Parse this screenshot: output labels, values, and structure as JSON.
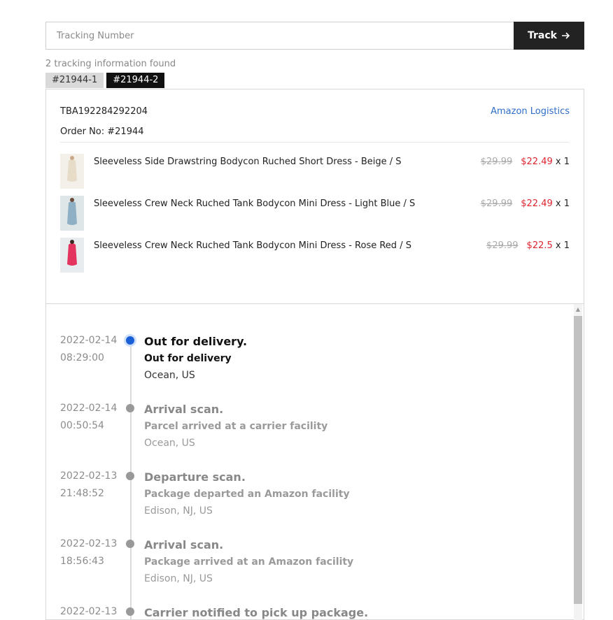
{
  "search": {
    "placeholder": "Tracking Number",
    "button_label": "Track",
    "button_icon": "arrow-right-icon"
  },
  "results": {
    "found_text": "2 tracking information found",
    "tabs": [
      {
        "label": "#21944-1",
        "active": false
      },
      {
        "label": "#21944-2",
        "active": true
      }
    ]
  },
  "order": {
    "tracking_number": "TBA192284292204",
    "order_no": "Order No: #21944",
    "carrier": "Amazon Logistics",
    "products": [
      {
        "name": "Sleeveless Side Drawstring Bodycon Ruched Short Dress - Beige / S",
        "original_price": "$29.99",
        "sale_price": "$22.49",
        "qty": " x 1",
        "thumb_color": "#e7dcc8"
      },
      {
        "name": "Sleeveless Crew Neck Ruched Tank Bodycon Mini Dress - Light Blue / S",
        "original_price": "$29.99",
        "sale_price": "$22.49",
        "qty": " x 1",
        "thumb_color": "#8fb0c4"
      },
      {
        "name": "Sleeveless Crew Neck Ruched Tank Bodycon Mini Dress - Rose Red / S",
        "original_price": "$29.99",
        "sale_price": "$22.5",
        "qty": " x 1",
        "thumb_color": "#e2345e"
      }
    ]
  },
  "timeline": [
    {
      "date": "2022-02-14",
      "time": "08:29:00",
      "title": "Out for delivery.",
      "desc": "Out for delivery",
      "loc": "Ocean, US",
      "current": true
    },
    {
      "date": "2022-02-14",
      "time": "00:50:54",
      "title": "Arrival scan.",
      "desc": "Parcel arrived at a carrier facility",
      "loc": "Ocean, US",
      "current": false
    },
    {
      "date": "2022-02-13",
      "time": "21:48:52",
      "title": "Departure scan.",
      "desc": "Package departed an Amazon facility",
      "loc": "Edison, NJ, US",
      "current": false
    },
    {
      "date": "2022-02-13",
      "time": "18:56:43",
      "title": "Arrival scan.",
      "desc": "Package arrived at an Amazon facility",
      "loc": "Edison, NJ, US",
      "current": false
    },
    {
      "date": "2022-02-13",
      "time": "",
      "title": "Carrier notified to pick up package.",
      "desc": "",
      "loc": "",
      "current": false
    }
  ],
  "colors": {
    "accent": "#1a5fd6",
    "sale": "#e0242e",
    "link": "#2f6dc9",
    "dark": "#222222"
  }
}
